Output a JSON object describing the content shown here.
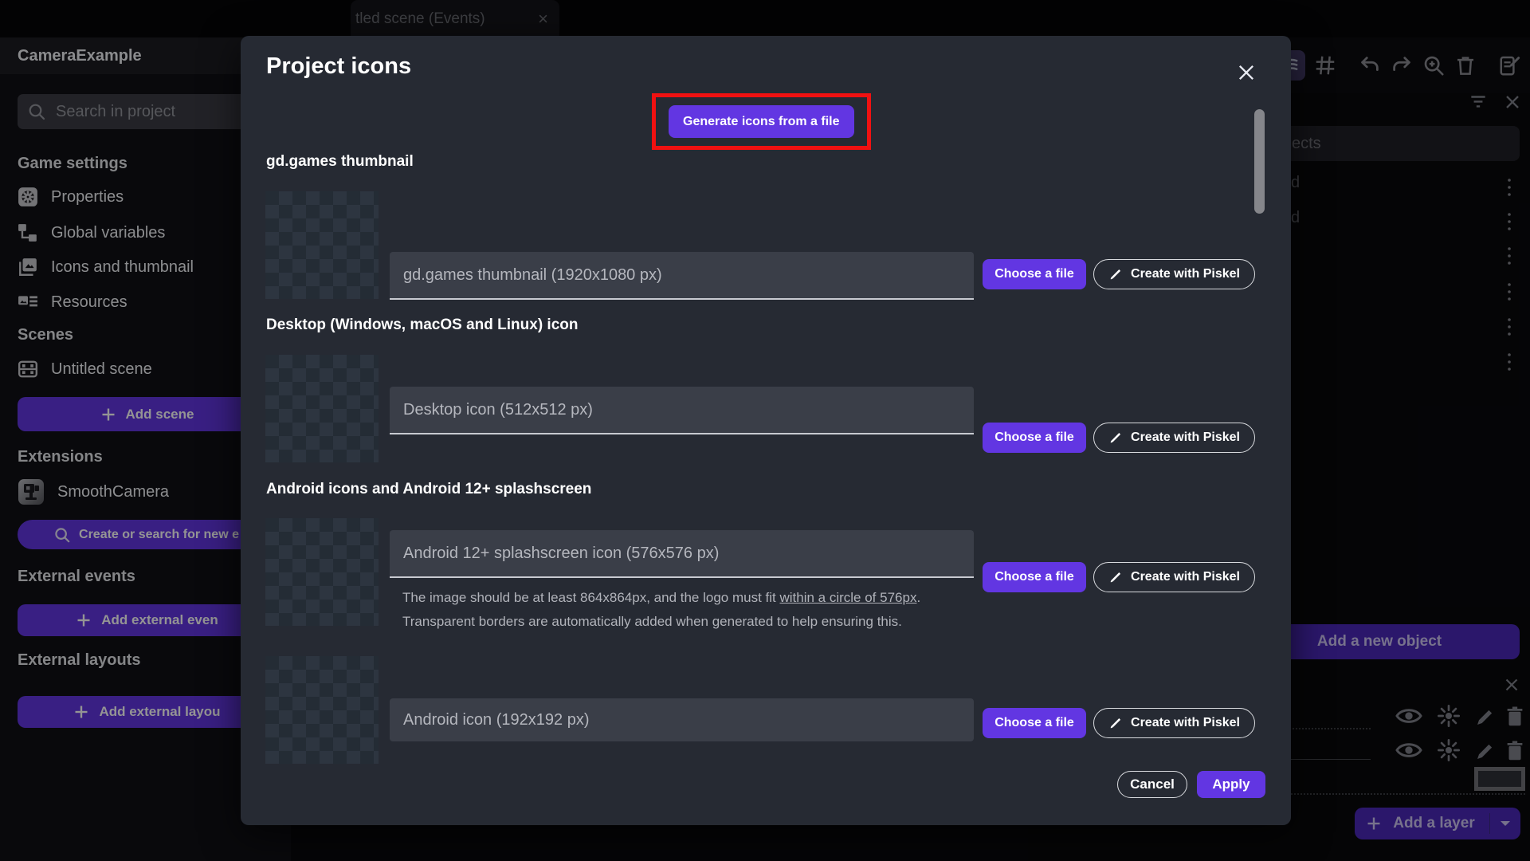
{
  "topbar": {
    "tab_label": "tled scene (Events)",
    "tab_close": "×"
  },
  "sidebar": {
    "project_name": "CameraExample",
    "search_placeholder": "Search in project",
    "game_settings_header": "Game settings",
    "items": [
      {
        "label": "Properties"
      },
      {
        "label": "Global variables"
      },
      {
        "label": "Icons and thumbnail"
      },
      {
        "label": "Resources"
      }
    ],
    "scenes_header": "Scenes",
    "scene_item": "Untitled scene",
    "add_scene": "Add scene",
    "extensions_header": "Extensions",
    "extension_item": "SmoothCamera",
    "create_search_extension": "Create or search for new e",
    "external_events_header": "External events",
    "add_external_events": "Add external even",
    "external_layouts_header": "External layouts",
    "add_external_layouts": "Add external layou"
  },
  "modal": {
    "title": "Project icons",
    "close": "×",
    "generate_button": "Generate icons from a file",
    "choose_file": "Choose a file",
    "create_piskel": "Create with Piskel",
    "cancel": "Cancel",
    "apply": "Apply",
    "sections": [
      {
        "header": "gd.games thumbnail",
        "placeholder": "gd.games thumbnail (1920x1080 px)"
      },
      {
        "header": "Desktop (Windows, macOS and Linux) icon",
        "placeholder": "Desktop icon (512x512 px)"
      },
      {
        "header": "Android icons and Android 12+ splashscreen",
        "placeholder": "Android 12+ splashscreen icon (576x576 px)",
        "help_line1_pre": "The image should be at least 864x864px, and the logo must fit ",
        "help_link": "within a circle of 576px",
        "help_line1_post": ".",
        "help_line2": "Transparent borders are automatically added when generated to help ensuring this."
      },
      {
        "placeholder": "Android icon (192x192 px)"
      }
    ]
  },
  "right_panel": {
    "search_fragment": "ects",
    "row_fragment_1": "d",
    "row_fragment_2": "d",
    "add_new_object": "Add a new object",
    "add_layer": "Add a layer"
  },
  "colors": {
    "accent": "#6236e2",
    "annotation_red": "#f01111"
  }
}
